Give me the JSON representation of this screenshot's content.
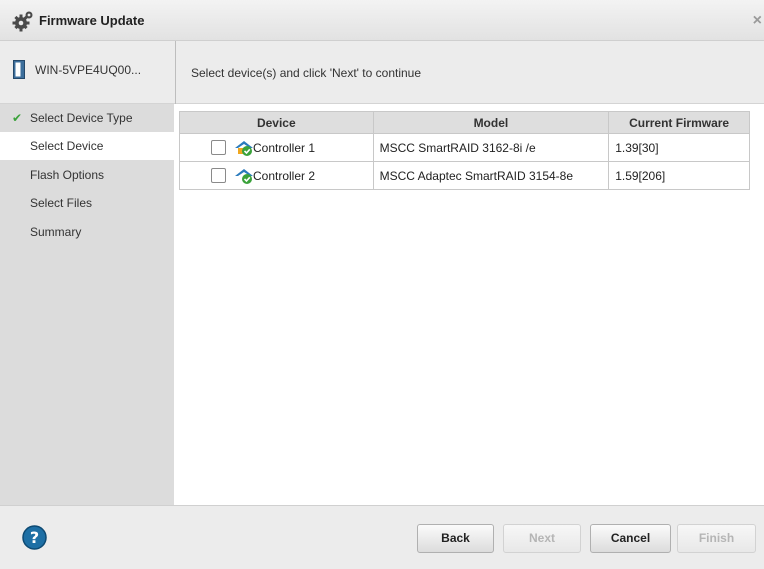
{
  "window": {
    "title": "Firmware Update",
    "close_glyph": "×"
  },
  "header": {
    "hostname": "WIN-5VPE4UQ00...",
    "instruction": "Select device(s) and click 'Next' to continue"
  },
  "nav": {
    "items": [
      {
        "label": "Select Device Type",
        "completed": true
      },
      {
        "label": "Select Device",
        "active": true
      },
      {
        "label": "Flash Options"
      },
      {
        "label": "Select Files"
      },
      {
        "label": "Summary"
      }
    ]
  },
  "table": {
    "columns": [
      "Device",
      "Model",
      "Current Firmware"
    ],
    "rows": [
      {
        "device": "Controller 1",
        "model": "MSCC SmartRAID 3162-8i /e",
        "firmware": "1.39[30]",
        "checked": false
      },
      {
        "device": "Controller 2",
        "model": "MSCC Adaptec SmartRAID 3154-8e",
        "firmware": "1.59[206]",
        "checked": false
      }
    ]
  },
  "footer": {
    "back_label": "Back",
    "next_label": "Next",
    "cancel_label": "Cancel",
    "finish_label": "Finish"
  },
  "icons": {
    "title": "gear-icon",
    "host": "server-icon",
    "device": "controller-icon",
    "help": "help-icon",
    "completed": "checkmark-icon"
  },
  "colors": {
    "check_green": "#3aa23a",
    "help_blue": "#1d6fa5"
  }
}
